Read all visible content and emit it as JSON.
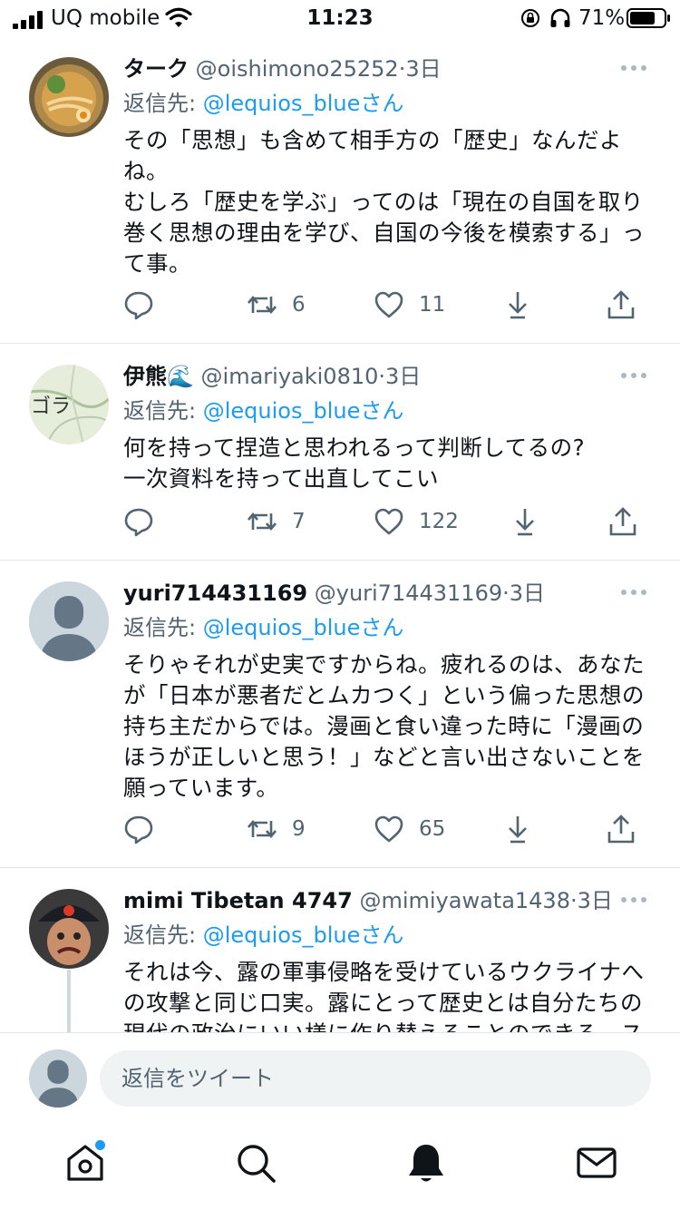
{
  "status": {
    "carrier": "UQ mobile",
    "time": "11:23",
    "battery": "71%"
  },
  "tweets": [
    {
      "name": "ターク",
      "handle": "@oishimono25252",
      "dot": "·",
      "time": "3日",
      "reply_label": "返信先:",
      "reply_to": "@lequios_blue",
      "reply_suffix": "さん",
      "text": "その「思想」も含めて相手方の「歴史」なんだよね。\nむしろ「歴史を学ぶ」ってのは「現在の自国を取り巻く思想の理由を学び、自国の今後を模索する」って事。",
      "retweets": "6",
      "likes": "11"
    },
    {
      "name": "伊熊🌊",
      "handle": "@imariyaki0810",
      "dot": "·",
      "time": "3日",
      "reply_label": "返信先:",
      "reply_to": "@lequios_blue",
      "reply_suffix": "さん",
      "avatar_text": "ゴラ",
      "text": "何を持って捏造と思われるって判断してるの?\n一次資料を持って出直してこい",
      "retweets": "7",
      "likes": "122"
    },
    {
      "name": "yuri714431169",
      "handle": "@yuri714431169",
      "dot": "·",
      "time": "3日",
      "reply_label": "返信先:",
      "reply_to": "@lequios_blue",
      "reply_suffix": "さん",
      "text": "そりゃそれが史実ですからね。疲れるのは、あなたが「日本が悪者だとムカつく」という偏った思想の持ち主だからでは。漫画と食い違った時に「漫画のほうが正しいと思う！」などと言い出さないことを願っています。",
      "retweets": "9",
      "likes": "65"
    },
    {
      "name": "mimi Tibetan 4747",
      "handle": "@mimiyawata1438",
      "dot": "·",
      "time": "3日",
      "reply_label": "返信先:",
      "reply_to": "@lequios_blue",
      "reply_suffix": "さん",
      "text": "それは今、露の軍事侵略を受けているウクライナへの攻撃と同じ口実。露にとって歴史とは自分たちの現代の政治にいい様に作り替えることのできる、ス"
    }
  ],
  "reply_input": {
    "placeholder": "返信をツイート"
  },
  "tabs": [
    "home",
    "search",
    "notifications",
    "messages"
  ],
  "colors": {
    "accent": "#1d9bf0",
    "muted": "#536471"
  }
}
